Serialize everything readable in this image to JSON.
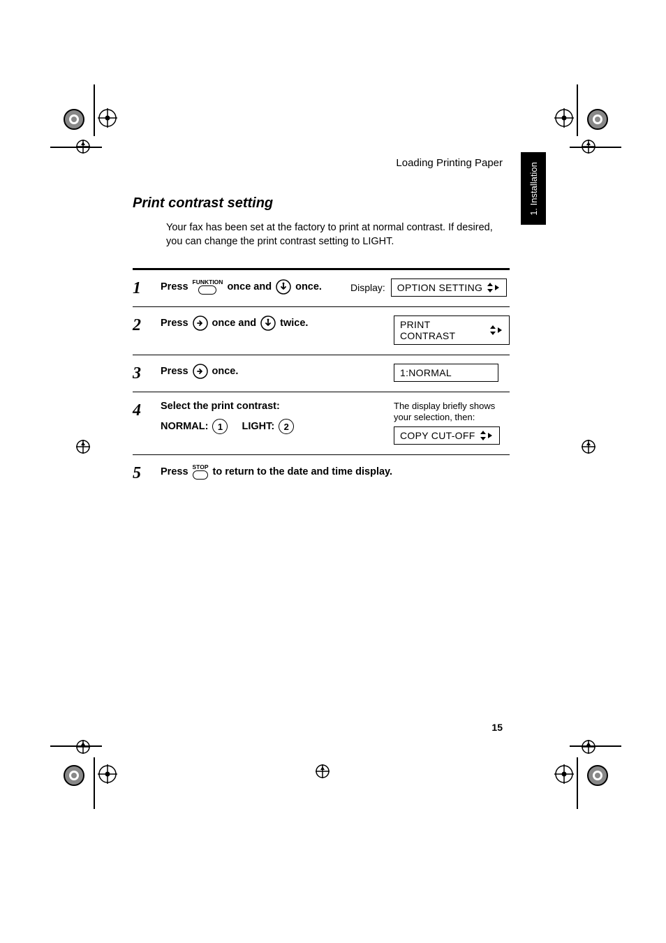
{
  "header": {
    "running_head": "Loading Printing Paper"
  },
  "chapter_tab": "1. Installation",
  "section": {
    "title": "Print contrast setting",
    "intro": "Your fax has been set at the factory to print at normal contrast. If desired, you can change the print contrast setting to LIGHT."
  },
  "keys": {
    "funktion": "FUNKTION",
    "stop": "STOP",
    "normal": "1",
    "light": "2"
  },
  "steps": {
    "s1": {
      "num": "1",
      "press": "Press",
      "mid": "once and",
      "end": "once.",
      "rhs_label": "Display:",
      "lcd": "OPTION SETTING"
    },
    "s2": {
      "num": "2",
      "press": "Press",
      "mid": "once and",
      "end": "twice.",
      "lcd": "PRINT CONTRAST"
    },
    "s3": {
      "num": "3",
      "press": "Press",
      "end": "once.",
      "lcd": "1:NORMAL"
    },
    "s4": {
      "num": "4",
      "line1": "Select the print contrast:",
      "normal_label": "NORMAL:",
      "light_label": "LIGHT:",
      "note": "The display briefly shows your selection, then:",
      "lcd": "COPY CUT-OFF"
    },
    "s5": {
      "num": "5",
      "press": "Press",
      "end": "to return to the date and time display."
    }
  },
  "page_number": "15"
}
